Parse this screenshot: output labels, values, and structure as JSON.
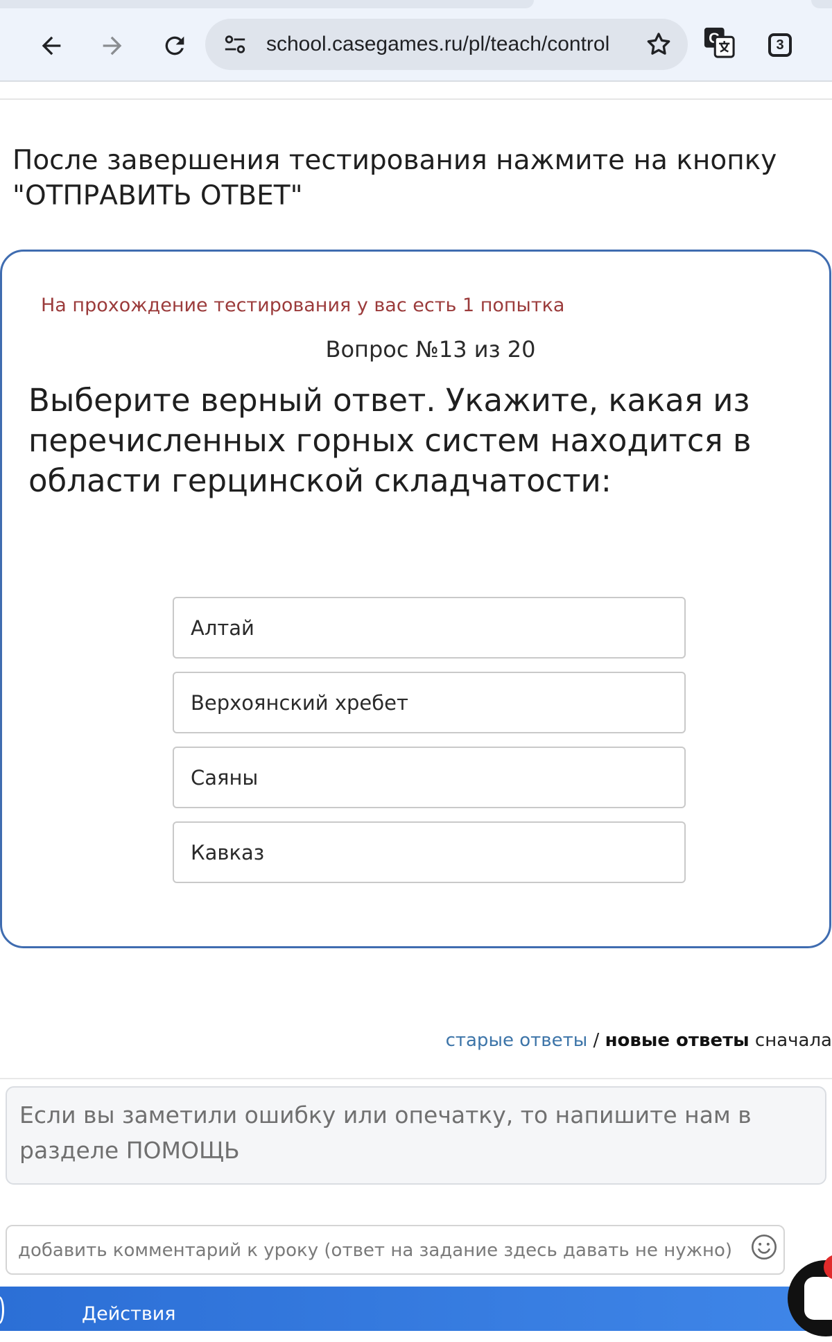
{
  "browser": {
    "url": "school.casegames.ru/pl/teach/control",
    "tab_count": "3"
  },
  "page": {
    "instructions": "После завершения тестирования нажмите на кнопку \"ОТПРАВИТЬ ОТВЕТ\""
  },
  "test": {
    "attempts": "На прохождение тестирования у вас есть 1 попытка",
    "counter": "Вопрос №13 из 20",
    "question": "Выберите верный ответ. Укажите, какая из перечисленных горных систем находится в области герцинской складчатости:",
    "answers": [
      {
        "label": "Алтай"
      },
      {
        "label": "Верхоянский хребет"
      },
      {
        "label": "Саяны"
      },
      {
        "label": "Кавказ"
      }
    ]
  },
  "comments": {
    "sort_old": "старые ответы",
    "sort_sep": " / ",
    "sort_new": "новые ответы",
    "sort_suffix": " сначала",
    "notice": "Если вы заметили ошибку или опечатку, то напишите нам в разделе ПОМОЩЬ",
    "placeholder": "добавить комментарий к уроку (ответ на задание здесь давать не нужно)"
  },
  "bottom_bar": {
    "actions_label": "Действия"
  },
  "icons": {
    "back": "arrow-left-icon",
    "forward": "arrow-right-icon",
    "reload": "reload-icon",
    "site_settings": "tune-icon",
    "bookmark": "star-icon",
    "translate": "translate-icon",
    "emoji": "smile-icon",
    "chat": "chat-icon"
  },
  "colors": {
    "card_border": "#3f6cb0",
    "attempts_text": "#9b3b3b",
    "link": "#3c74a8",
    "bottom_bar": "#2c6fd6",
    "chat_badge": "#e02b2b"
  }
}
